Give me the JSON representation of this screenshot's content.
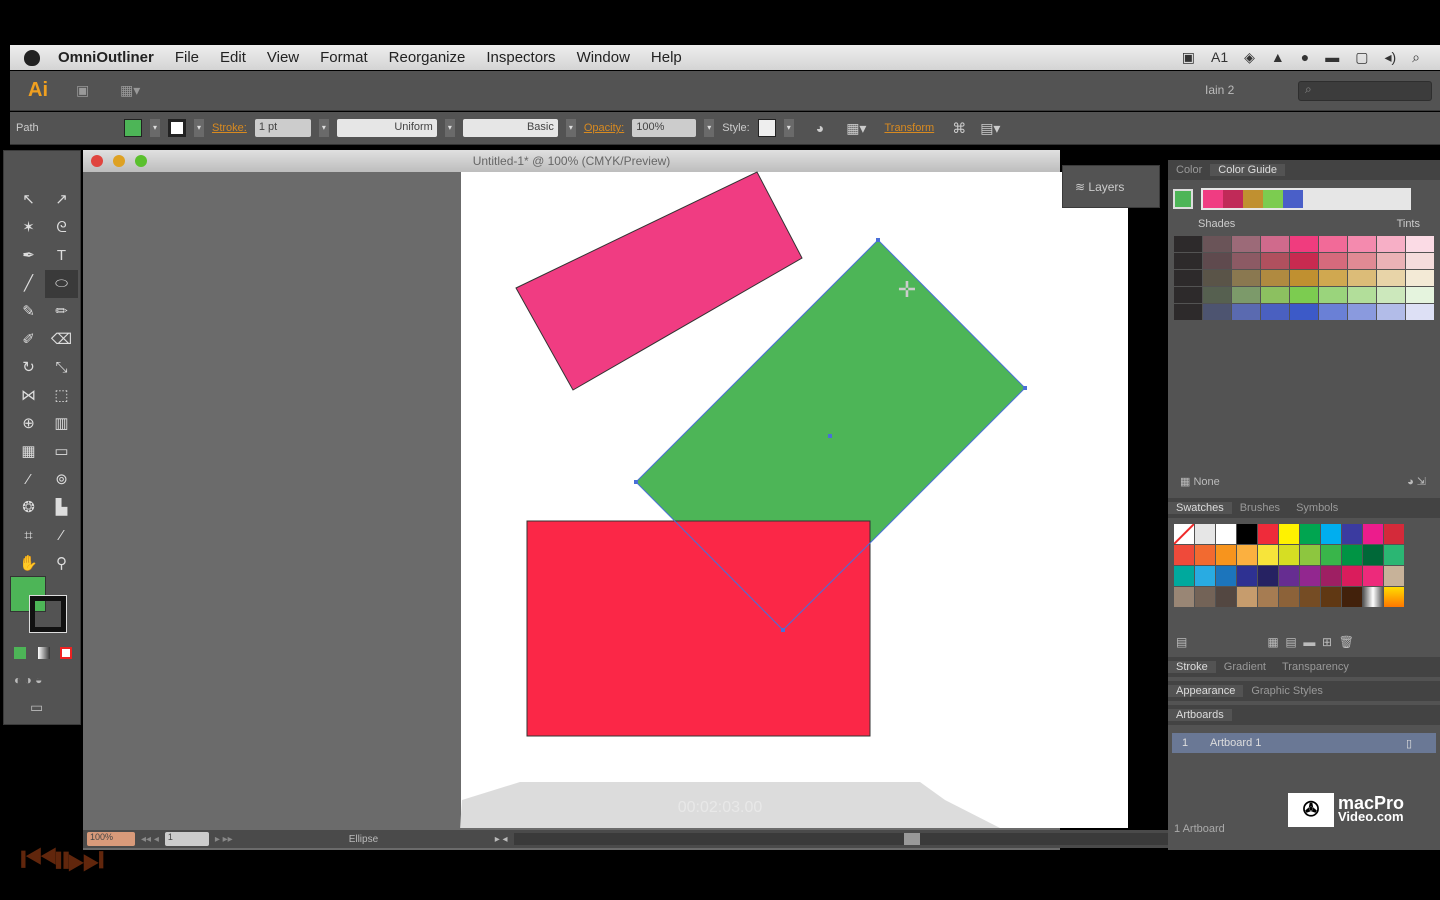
{
  "menubar": {
    "app": "OmniOutliner",
    "items": [
      "File",
      "Edit",
      "View",
      "Format",
      "Reorganize",
      "Inspectors",
      "Window",
      "Help"
    ],
    "tray_icons": [
      "camera-icon",
      "adobe-icon",
      "dropbox-icon",
      "bell-icon",
      "sync-icon",
      "display-icon",
      "window-icon",
      "volume-icon",
      "spotlight-icon"
    ],
    "tray_count": "1"
  },
  "appbar": {
    "logo": "Ai",
    "workspace": "Iain 2",
    "search_placeholder": "⌕"
  },
  "control": {
    "object_type": "Path",
    "stroke_label": "Stroke:",
    "stroke_weight": "1 pt",
    "profile": "Uniform",
    "brush": "Basic",
    "opacity_label": "Opacity:",
    "opacity": "100%",
    "style_label": "Style:",
    "transform_label": "Transform",
    "fill_color": "#4db557"
  },
  "document": {
    "title": "Untitled-1* @ 100% (CMYK/Preview)"
  },
  "shapes": {
    "pink": "#f03c82",
    "green": "#4db557",
    "red": "#fb2747",
    "selection": "#4a6fd8"
  },
  "layers": {
    "label": "Layers"
  },
  "color_panel": {
    "tabs": [
      "Color",
      "Color Guide"
    ],
    "active": 1,
    "harmony": [
      "#f03c82",
      "#c02a58",
      "#c09030",
      "#7ccc50",
      "#4a5fc8"
    ],
    "shades_label": "Shades",
    "tints_label": "Tints",
    "grid": [
      [
        "#2d2a2b",
        "#6a5458",
        "#9c6a78",
        "#d06a8c",
        "#f03c7e",
        "#f26a98",
        "#f48aae",
        "#f7afc6",
        "#fbdbe5"
      ],
      [
        "#2d2a2b",
        "#5f4a4e",
        "#8c5a64",
        "#b0505e",
        "#c82a50",
        "#d66a7c",
        "#e08a94",
        "#ebb2b6",
        "#f5dcdc"
      ],
      [
        "#2d2a2b",
        "#5a5448",
        "#8a7850",
        "#b08a40",
        "#c09030",
        "#d0a850",
        "#dcbc78",
        "#e8d4a8",
        "#f3ead6"
      ],
      [
        "#2d2a2b",
        "#566050",
        "#7c9a6a",
        "#8cc060",
        "#7ccc50",
        "#9ad47c",
        "#b2de9a",
        "#cce8bc",
        "#e5f4de"
      ],
      [
        "#2d2a2b",
        "#4d5470",
        "#5a6ab0",
        "#4a60c0",
        "#3c5ac8",
        "#6a80d6",
        "#8a9ade",
        "#b2bce8",
        "#dde0f5"
      ]
    ],
    "footer": "None"
  },
  "swatches": {
    "tabs": [
      "Swatches",
      "Brushes",
      "Symbols"
    ],
    "colors": [
      "#ffffff",
      "#e6e6e6",
      "#ffffff",
      "#000000",
      "#ef2b3a",
      "#fff200",
      "#00a550",
      "#00aeef",
      "#3b3ba0",
      "#ec1c8c",
      "#d42a3a",
      "#ef4a3a",
      "#f26a30",
      "#f7941d",
      "#fbb040",
      "#f7e43a",
      "#d6de23",
      "#8dc63f",
      "#39b54a",
      "#009444",
      "#006838",
      "#2bb673",
      "#00a99d",
      "#29abe2",
      "#1c75bc",
      "#2e3192",
      "#262262",
      "#662d91",
      "#92278f",
      "#9e1f63",
      "#da1c5c",
      "#ed2a7b",
      "#c7b299",
      "#998675",
      "#736357",
      "#534741",
      "#c69c6d",
      "#a67c52",
      "#8c6239",
      "#754c24",
      "#603813",
      "#42210b",
      "#bbbbbb",
      "#fbb034"
    ]
  },
  "lower_panels": {
    "row1": [
      "Stroke",
      "Gradient",
      "Transparency"
    ],
    "row2": [
      "Appearance",
      "Graphic Styles"
    ],
    "row3": [
      "Artboards"
    ]
  },
  "artboards": {
    "rows": [
      {
        "num": "1",
        "name": "Artboard 1"
      }
    ],
    "count": "1 Artboard"
  },
  "status": {
    "zoom": "100%",
    "artboard": "1",
    "tool": "Ellipse"
  },
  "watermark": {
    "brand": "macPro",
    "site": "Video.com",
    "timestamp": "00:02:03.00"
  }
}
